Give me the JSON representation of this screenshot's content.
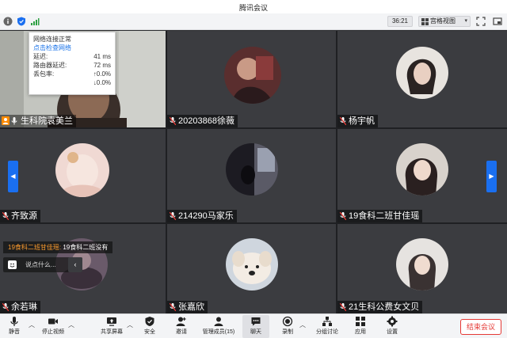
{
  "window": {
    "title": "腾讯会议"
  },
  "topbar": {
    "timer": "36:21",
    "view_label": "宫格视图"
  },
  "network_popup": {
    "status": "网络连接正常",
    "check_link": "点击检查网络",
    "rows": [
      {
        "label": "延迟:",
        "value": "41 ms"
      },
      {
        "label": "路由器延迟:",
        "value": "72 ms"
      },
      {
        "label": "丢包率:",
        "value": "↑0.0%"
      },
      {
        "label": "",
        "value": "↓0.0%"
      }
    ]
  },
  "participants": [
    {
      "name": "生科院袁美兰"
    },
    {
      "name": "20203868徐薇"
    },
    {
      "name": "杨宇帆"
    },
    {
      "name": "齐致源"
    },
    {
      "name": "214290马家乐"
    },
    {
      "name": "19食科二班甘佳瑶"
    },
    {
      "name": "余若琳"
    },
    {
      "name": "张嘉欣"
    },
    {
      "name": "21生科公费女文贝"
    }
  ],
  "chat": {
    "sender": "19食科二班甘佳瑶:",
    "message": "19食科二班没有",
    "input_placeholder": "说点什么..."
  },
  "bottombar": {
    "mute": "静音",
    "stop_video": "停止视频",
    "share": "共享屏幕",
    "security": "安全",
    "invite": "邀请",
    "members": "管理成员(15)",
    "chat": "聊天",
    "record": "录制",
    "breakout": "分组讨论",
    "apps": "应用",
    "settings": "设置",
    "end_meeting": "结束会议"
  },
  "colors": {
    "accent": "#1a6ff0",
    "end_red": "#e53935",
    "chat_sender": "#ff9d2e"
  }
}
